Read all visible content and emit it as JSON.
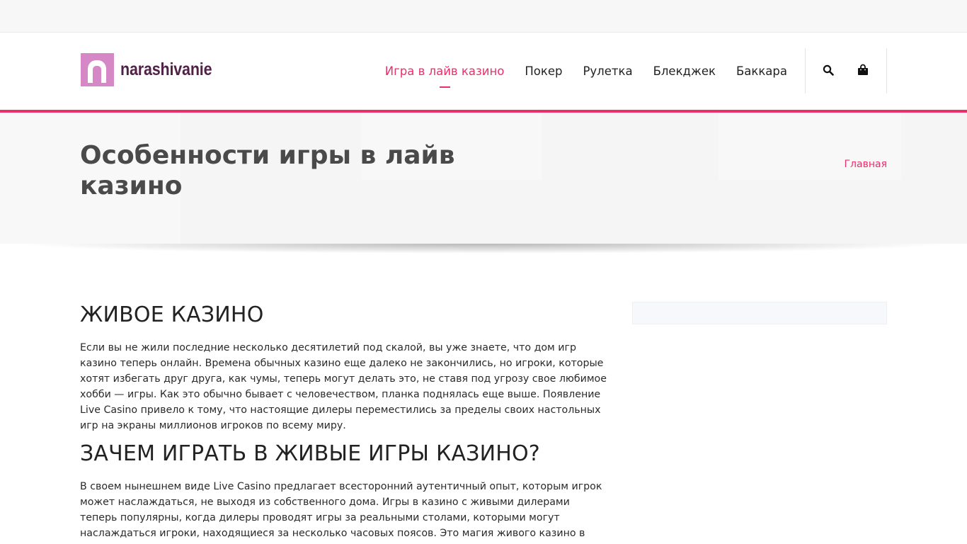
{
  "logo": {
    "text": "narashivanie"
  },
  "nav": {
    "items": [
      {
        "label": "Игра в лайв казино",
        "active": true
      },
      {
        "label": "Покер",
        "active": false
      },
      {
        "label": "Рулетка",
        "active": false
      },
      {
        "label": "Блекджек",
        "active": false
      },
      {
        "label": "Баккара",
        "active": false
      }
    ]
  },
  "icons": {
    "search": "search-icon",
    "cart": "shopping-bag-icon"
  },
  "colors": {
    "accent": "#ea2f6a",
    "logo_mark": "#d688c6",
    "logo_text": "#512148"
  },
  "hero": {
    "title": "Особенности игры в лайв казино",
    "breadcrumb": "Главная"
  },
  "article": {
    "heading1": "ЖИВОЕ КАЗИНО",
    "paragraph1": "Если вы не жили последние несколько десятилетий под скалой, вы уже знаете, что дом игр казино теперь онлайн. Времена обычных казино еще далеко не закончились, но игроки, которые хотят избегать друг друга, как чумы, теперь могут делать это, не ставя под угрозу свое любимое хобби — игры. Как это обычно бывает с человечеством, планка поднялась еще выше. Появление Live Casino привело к тому, что настоящие дилеры переместились за пределы своих настольных игр на экраны миллионов игроков по всему миру.",
    "heading2": "ЗАЧЕМ ИГРАТЬ В ЖИВЫЕ ИГРЫ КАЗИНО?",
    "paragraph2": "В своем нынешнем виде Live Casino предлагает всесторонний аутентичный опыт, которым игрок может наслаждаться, не выходя из собственного дома. Игры в казино с живыми дилерами теперь популярны, когда дилеры проводят игры за реальными столами, которыми могут наслаждаться игроки, находящиеся за несколько часовых поясов. Это магия живого казино в действии!"
  }
}
